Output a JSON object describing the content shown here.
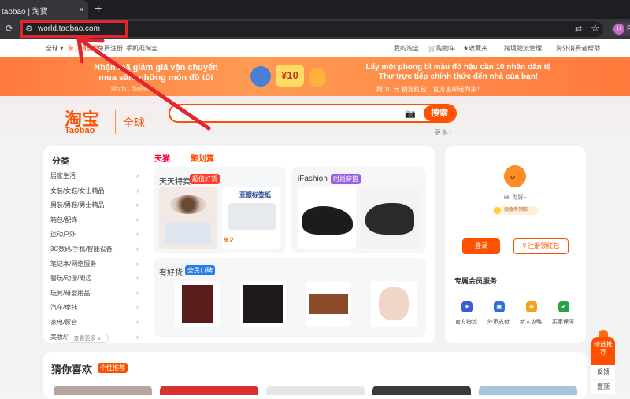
{
  "browser": {
    "tab_title": "taobao | 淘寶",
    "tab_close": "×",
    "new_tab": "+",
    "reload_icon": "reload-icon",
    "url": "world.taobao.com",
    "profile_initial": "H",
    "profile_letter": "P"
  },
  "topbar": {
    "region": "全球 ▾",
    "login_prompt": "亲，请登录",
    "register": "免费注册",
    "mobile": "手机逛淘宝",
    "my_taobao": "我的淘宝",
    "cart": "购物车",
    "favorites": "收藏夹",
    "cross_border": "跨境物流管理",
    "help": "海外消费者帮助"
  },
  "promo": {
    "left_line1": "Nhận mã giảm giá vận chuyển",
    "left_line2": "mua sắm những món đồ tốt",
    "left_sub": "领红包，淘好物",
    "badge": "¥10",
    "right_line1": "Lấy một phong bì màu đỏ hậu cần 10 nhân dân tệ",
    "right_line2": "Thư trực tiếp chính thức đến nhà của bạn!",
    "right_sub": "抢 10 元 物流红包，官方直邮送到家！"
  },
  "header": {
    "logo_cn": "淘宝",
    "logo_en": "Taobao",
    "logo_global": "全球",
    "search_button": "搜索",
    "search_more": "更多 ›"
  },
  "categories": {
    "title": "分类",
    "items": [
      "居家生活",
      "女装/女鞋/女士精品",
      "男装/男鞋/男士精品",
      "箱包/配饰",
      "运动户外",
      "3C数码/手机/智能设备",
      "笔记本/网络服务",
      "餐玩/动漫/周边",
      "玩具/母婴用品",
      "汽车/摩托",
      "家电/影音",
      "美妆/洗护"
    ],
    "more": "查看更多 ∨"
  },
  "channel_tabs": {
    "tmall": "天猫",
    "juhuasuan": "聚划算"
  },
  "daily_deals": {
    "title": "天天特卖",
    "pill": "超值好货",
    "price_tag": "9.2",
    "label_product": "亚银标签纸"
  },
  "ifashion": {
    "title": "iFashion",
    "pill": "时尚穿搭"
  },
  "good_goods": {
    "title": "有好货",
    "pill": "全民口碑"
  },
  "user": {
    "greeting": "Hi! 你好~",
    "member": "淘金币领取",
    "login": "登录",
    "redpack": "¥ 注册领红包"
  },
  "services": {
    "title": "专属会员服务",
    "items": [
      {
        "label": "官方物流",
        "icon": "logistics-icon",
        "color": "#3d5bd9"
      },
      {
        "label": "外币支付",
        "icon": "wallet-icon",
        "color": "#2f6fe0"
      },
      {
        "label": "新人攻略",
        "icon": "compass-icon",
        "color": "#f0a318"
      },
      {
        "label": "买家保障",
        "icon": "shield-icon",
        "color": "#2aa24a"
      }
    ]
  },
  "guess": {
    "title": "猜你喜欢",
    "pill": "个性推荐"
  },
  "float_bar": {
    "recommend": "精选推荐",
    "feedback": "反馈",
    "top": "置顶"
  }
}
